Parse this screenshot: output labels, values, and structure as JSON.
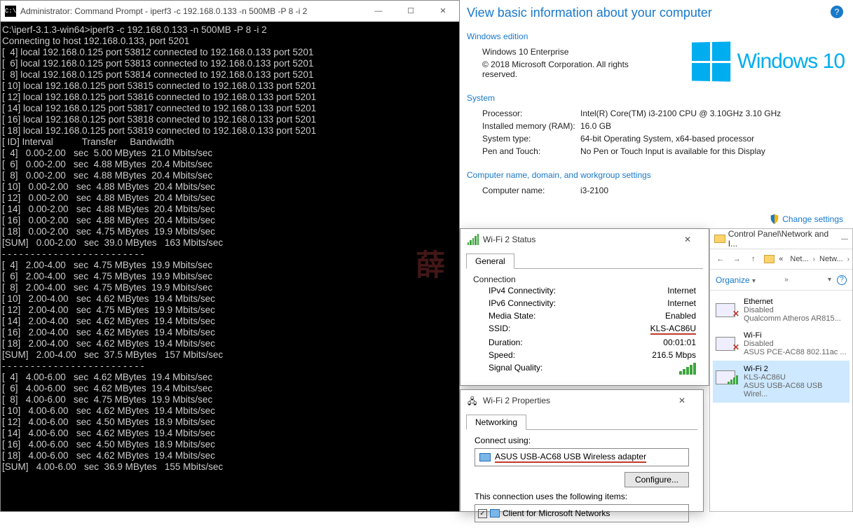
{
  "cmd": {
    "title": "Administrator: Command Prompt - iperf3  -c 192.168.0.133 -n 500MB -P 8 -i 2",
    "icon_label": "C:\\",
    "prompt_line": "C:\\iperf-3.1.3-win64>iperf3 -c 192.168.0.133 -n 500MB -P 8 -i 2",
    "connecting": "Connecting to host 192.168.0.133, port 5201",
    "conn_lines": [
      "[  4] local 192.168.0.125 port 53812 connected to 192.168.0.133 port 5201",
      "[  6] local 192.168.0.125 port 53813 connected to 192.168.0.133 port 5201",
      "[  8] local 192.168.0.125 port 53814 connected to 192.168.0.133 port 5201",
      "[ 10] local 192.168.0.125 port 53815 connected to 192.168.0.133 port 5201",
      "[ 12] local 192.168.0.125 port 53816 connected to 192.168.0.133 port 5201",
      "[ 14] local 192.168.0.125 port 53817 connected to 192.168.0.133 port 5201",
      "[ 16] local 192.168.0.125 port 53818 connected to 192.168.0.133 port 5201",
      "[ 18] local 192.168.0.125 port 53819 connected to 192.168.0.133 port 5201"
    ],
    "header": "[ ID] Interval           Transfer     Bandwidth",
    "blocks": [
      [
        "[  4]   0.00-2.00   sec  5.00 MBytes  21.0 Mbits/sec",
        "[  6]   0.00-2.00   sec  4.88 MBytes  20.4 Mbits/sec",
        "[  8]   0.00-2.00   sec  4.88 MBytes  20.4 Mbits/sec",
        "[ 10]   0.00-2.00   sec  4.88 MBytes  20.4 Mbits/sec",
        "[ 12]   0.00-2.00   sec  4.88 MBytes  20.4 Mbits/sec",
        "[ 14]   0.00-2.00   sec  4.88 MBytes  20.4 Mbits/sec",
        "[ 16]   0.00-2.00   sec  4.88 MBytes  20.4 Mbits/sec",
        "[ 18]   0.00-2.00   sec  4.75 MBytes  19.9 Mbits/sec",
        "[SUM]   0.00-2.00   sec  39.0 MBytes   163 Mbits/sec"
      ],
      [
        "[  4]   2.00-4.00   sec  4.75 MBytes  19.9 Mbits/sec",
        "[  6]   2.00-4.00   sec  4.75 MBytes  19.9 Mbits/sec",
        "[  8]   2.00-4.00   sec  4.75 MBytes  19.9 Mbits/sec",
        "[ 10]   2.00-4.00   sec  4.62 MBytes  19.4 Mbits/sec",
        "[ 12]   2.00-4.00   sec  4.75 MBytes  19.9 Mbits/sec",
        "[ 14]   2.00-4.00   sec  4.62 MBytes  19.4 Mbits/sec",
        "[ 16]   2.00-4.00   sec  4.62 MBytes  19.4 Mbits/sec",
        "[ 18]   2.00-4.00   sec  4.62 MBytes  19.4 Mbits/sec",
        "[SUM]   2.00-4.00   sec  37.5 MBytes   157 Mbits/sec"
      ],
      [
        "[  4]   4.00-6.00   sec  4.62 MBytes  19.4 Mbits/sec",
        "[  6]   4.00-6.00   sec  4.62 MBytes  19.4 Mbits/sec",
        "[  8]   4.00-6.00   sec  4.75 MBytes  19.9 Mbits/sec",
        "[ 10]   4.00-6.00   sec  4.62 MBytes  19.4 Mbits/sec",
        "[ 12]   4.00-6.00   sec  4.50 MBytes  18.9 Mbits/sec",
        "[ 14]   4.00-6.00   sec  4.62 MBytes  19.4 Mbits/sec",
        "[ 16]   4.00-6.00   sec  4.50 MBytes  18.9 Mbits/sec",
        "[ 18]   4.00-6.00   sec  4.62 MBytes  19.4 Mbits/sec",
        "[SUM]   4.00-6.00   sec  36.9 MBytes   155 Mbits/sec"
      ]
    ],
    "sep": "- - - - - - - - - - - - - - - - - - - - - - - - -",
    "watermark": "薛"
  },
  "sysinfo": {
    "heading": "View basic information about your computer",
    "edition_hdr": "Windows edition",
    "edition": "Windows 10 Enterprise",
    "copyright": "© 2018 Microsoft Corporation. All rights reserved.",
    "logo_text": "Windows 10",
    "system_hdr": "System",
    "processor_label": "Processor:",
    "processor": "Intel(R) Core(TM) i3-2100 CPU @ 3.10GHz   3.10 GHz",
    "ram_label": "Installed memory (RAM):",
    "ram": "16.0 GB",
    "type_label": "System type:",
    "type": "64-bit Operating System, x64-based processor",
    "pen_label": "Pen and Touch:",
    "pen": "No Pen or Touch Input is available for this Display",
    "cname_hdr": "Computer name, domain, and workgroup settings",
    "cname_label": "Computer name:",
    "cname": "i3-2100",
    "change_link": "Change settings"
  },
  "wifi_status": {
    "title": "Wi-Fi 2 Status",
    "tab": "General",
    "section": "Connection",
    "rows": {
      "ipv4_l": "IPv4 Connectivity:",
      "ipv4_v": "Internet",
      "ipv6_l": "IPv6 Connectivity:",
      "ipv6_v": "Internet",
      "media_l": "Media State:",
      "media_v": "Enabled",
      "ssid_l": "SSID:",
      "ssid_v": "KLS-AC86U",
      "dur_l": "Duration:",
      "dur_v": "00:01:01",
      "speed_l": "Speed:",
      "speed_v": "216.5 Mbps",
      "sq_l": "Signal Quality:"
    }
  },
  "wifi_props": {
    "title": "Wi-Fi 2 Properties",
    "tab": "Networking",
    "connect_using": "Connect using:",
    "adapter": "ASUS USB-AC68 USB Wireless adapter",
    "configure": "Configure...",
    "items_label": "This connection uses the following items:",
    "item1": "Client for Microsoft Networks"
  },
  "explorer": {
    "title": "Control Panel\\Network and I...",
    "crumb1": "Net...",
    "crumb2": "Netw...",
    "organize": "Organize",
    "items": [
      {
        "name": "Ethernet",
        "status": "Disabled",
        "dev": "Qualcomm Atheros AR815..."
      },
      {
        "name": "Wi-Fi",
        "status": "Disabled",
        "dev": "ASUS PCE-AC88 802.11ac ..."
      },
      {
        "name": "Wi-Fi 2",
        "status": "KLS-AC86U",
        "dev": "ASUS USB-AC68 USB Wirel..."
      }
    ]
  }
}
